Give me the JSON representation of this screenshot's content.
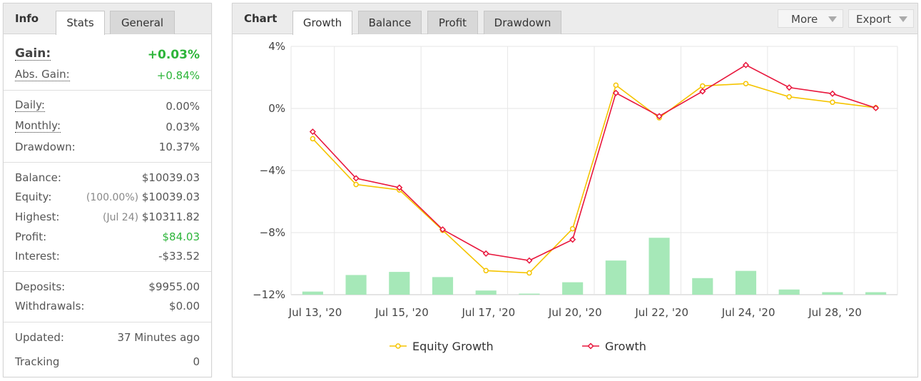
{
  "info": {
    "title": "Info",
    "tabs": [
      "Stats",
      "General"
    ],
    "gain": {
      "label": "Gain:",
      "value": "+0.03%"
    },
    "abs_gain": {
      "label": "Abs. Gain:",
      "value": "+0.84%"
    },
    "daily": {
      "label": "Daily:",
      "value": "0.00%"
    },
    "monthly": {
      "label": "Monthly:",
      "value": "0.03%"
    },
    "drawdown": {
      "label": "Drawdown:",
      "value": "10.37%"
    },
    "balance": {
      "label": "Balance:",
      "value": "$10039.03"
    },
    "equity": {
      "label": "Equity:",
      "note": "(100.00%)",
      "value": "$10039.03"
    },
    "highest": {
      "label": "Highest:",
      "note": "(Jul 24)",
      "value": "$10311.82"
    },
    "profit": {
      "label": "Profit:",
      "value": "$84.03"
    },
    "interest": {
      "label": "Interest:",
      "value": "-$33.52"
    },
    "deposits": {
      "label": "Deposits:",
      "value": "$9955.00"
    },
    "withdrawals": {
      "label": "Withdrawals:",
      "value": "$0.00"
    },
    "updated": {
      "label": "Updated:",
      "value": "37 Minutes ago"
    },
    "tracking": {
      "label": "Tracking",
      "value": "0"
    }
  },
  "chart_panel": {
    "title": "Chart",
    "tabs": [
      "Growth",
      "Balance",
      "Profit",
      "Drawdown"
    ],
    "more_label": "More",
    "export_label": "Export"
  },
  "chart_data": {
    "type": "line",
    "y_ticks": [
      "4%",
      "0%",
      "−4%",
      "−8%",
      "−12%"
    ],
    "ylim": [
      -12,
      4
    ],
    "x_tick_labels": [
      "Jul 13, '20",
      "Jul 15, '20",
      "Jul 17, '20",
      "Jul 20, '20",
      "Jul 22, '20",
      "Jul 24, '20",
      "Jul 28, '20"
    ],
    "x_points": 14,
    "series": [
      {
        "name": "Equity Growth",
        "color": "#f5c400",
        "values": [
          -1.95,
          -4.9,
          -5.25,
          -7.85,
          -10.45,
          -10.6,
          -7.75,
          1.5,
          -0.6,
          1.45,
          1.6,
          0.75,
          0.4,
          0.05
        ]
      },
      {
        "name": "Growth",
        "color": "#e8163c",
        "values": [
          -1.5,
          -4.5,
          -5.1,
          -7.8,
          -9.35,
          -9.8,
          -8.45,
          1.0,
          -0.5,
          1.1,
          2.8,
          1.35,
          0.95,
          0.03
        ]
      }
    ],
    "bars": {
      "color": "#a6e8b8",
      "values": [
        0.15,
        0.95,
        1.1,
        0.85,
        0.2,
        0.05,
        0.6,
        1.65,
        2.75,
        0.8,
        1.15,
        0.25,
        0.12,
        0.12
      ],
      "scale_max": 12
    },
    "grid": true,
    "legend_position": "bottom-center"
  }
}
